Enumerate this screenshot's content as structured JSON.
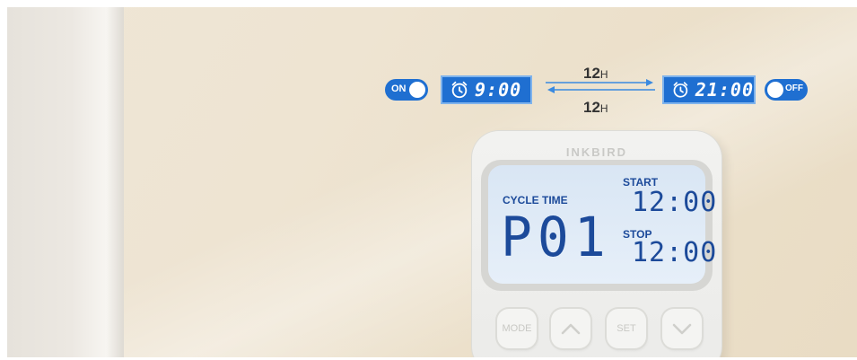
{
  "schedule": {
    "on_toggle": {
      "label": "ON"
    },
    "off_toggle": {
      "label": "OFF"
    },
    "on_time": "9:00",
    "off_time": "21:00",
    "top_interval": {
      "value": "12",
      "unit": "H"
    },
    "bottom_interval": {
      "value": "12",
      "unit": "H"
    },
    "accent_color": "#1f6fd1"
  },
  "device": {
    "brand": "INKBIRD",
    "lcd": {
      "cycle_label": "CYCLE TIME",
      "program": "P01",
      "start_label": "START",
      "start_time": "12:00",
      "stop_label": "STOP",
      "stop_time": "12:00"
    },
    "buttons": {
      "mode": "MODE",
      "set": "SET"
    }
  }
}
